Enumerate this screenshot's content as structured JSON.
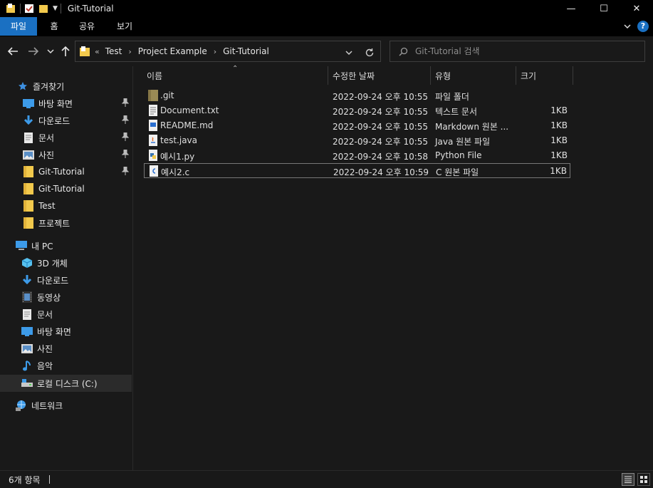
{
  "window": {
    "title": "Git-Tutorial"
  },
  "ribbon": {
    "tabs": [
      "파일",
      "홈",
      "공유",
      "보기"
    ],
    "help_label": "?"
  },
  "nav": {
    "breadcrumb_prefix": "«",
    "breadcrumbs": [
      "Test",
      "Project Example",
      "Git-Tutorial"
    ],
    "search_placeholder": "Git-Tutorial 검색"
  },
  "sidebar": {
    "quick_access": "즐겨찾기",
    "quick_items": [
      {
        "label": "바탕 화면",
        "icon": "desktop-icon",
        "pinned": true
      },
      {
        "label": "다운로드",
        "icon": "download-icon",
        "pinned": true
      },
      {
        "label": "문서",
        "icon": "document-icon",
        "pinned": true
      },
      {
        "label": "사진",
        "icon": "picture-icon",
        "pinned": true
      },
      {
        "label": "Git-Tutorial",
        "icon": "folder-icon",
        "pinned": true
      },
      {
        "label": "Git-Tutorial",
        "icon": "folder-icon",
        "pinned": false
      },
      {
        "label": "Test",
        "icon": "folder-icon",
        "pinned": false
      },
      {
        "label": "프로젝트",
        "icon": "folder-icon",
        "pinned": false
      }
    ],
    "this_pc": "내 PC",
    "pc_items": [
      {
        "label": "3D 개체",
        "icon": "3d-objects-icon"
      },
      {
        "label": "다운로드",
        "icon": "download-icon"
      },
      {
        "label": "동영상",
        "icon": "video-icon"
      },
      {
        "label": "문서",
        "icon": "document-icon"
      },
      {
        "label": "바탕 화면",
        "icon": "desktop-icon"
      },
      {
        "label": "사진",
        "icon": "picture-icon"
      },
      {
        "label": "음악",
        "icon": "music-icon"
      },
      {
        "label": "로컬 디스크 (C:)",
        "icon": "drive-icon"
      }
    ],
    "network": "네트워크"
  },
  "columns": {
    "name": "이름",
    "date": "수정한 날짜",
    "type": "유형",
    "size": "크기"
  },
  "files": [
    {
      "name": ".git",
      "date": "2022-09-24 오후 10:55",
      "type": "파일 폴더",
      "size": "",
      "icon": "git-folder-icon"
    },
    {
      "name": "Document.txt",
      "date": "2022-09-24 오후 10:55",
      "type": "텍스트 문서",
      "size": "1KB",
      "icon": "text-file-icon"
    },
    {
      "name": "README.md",
      "date": "2022-09-24 오후 10:55",
      "type": "Markdown 원본 ...",
      "size": "1KB",
      "icon": "markdown-file-icon"
    },
    {
      "name": "test.java",
      "date": "2022-09-24 오후 10:55",
      "type": "Java 원본 파일",
      "size": "1KB",
      "icon": "java-file-icon"
    },
    {
      "name": "예시1.py",
      "date": "2022-09-24 오후 10:58",
      "type": "Python File",
      "size": "1KB",
      "icon": "python-file-icon"
    },
    {
      "name": "예시2.c",
      "date": "2022-09-24 오후 10:59",
      "type": "C 원본 파일",
      "size": "1KB",
      "icon": "c-file-icon"
    }
  ],
  "status": {
    "item_count": "6개 항목"
  },
  "colors": {
    "accent": "#1a70c2",
    "background": "#191919",
    "titlebar": "#000000",
    "folder": "#f2c94c"
  }
}
